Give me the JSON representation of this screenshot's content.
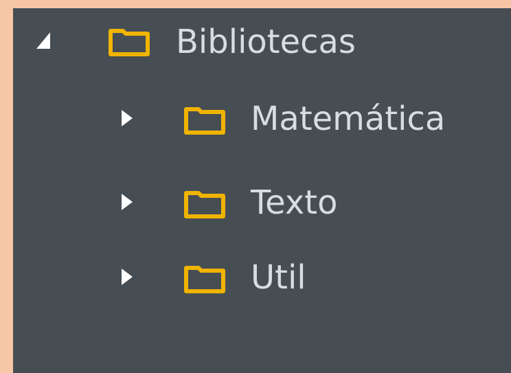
{
  "tree": {
    "root": {
      "label": "Bibliotecas",
      "expanded": true,
      "icon": "folder-icon",
      "toggle_icon": "expanded-triangle-icon"
    },
    "children": [
      {
        "label": "Matemática",
        "expanded": false,
        "icon": "folder-icon",
        "toggle_icon": "collapsed-triangle-icon"
      },
      {
        "label": "Texto",
        "expanded": false,
        "icon": "folder-icon",
        "toggle_icon": "collapsed-triangle-icon"
      },
      {
        "label": "Util",
        "expanded": false,
        "icon": "folder-icon",
        "toggle_icon": "collapsed-triangle-icon"
      }
    ]
  },
  "colors": {
    "page_background": "#f7c6a6",
    "panel_background": "#464e54",
    "text": "#d7dde0",
    "folder": "#f0b400",
    "toggle": "#ffffff"
  }
}
